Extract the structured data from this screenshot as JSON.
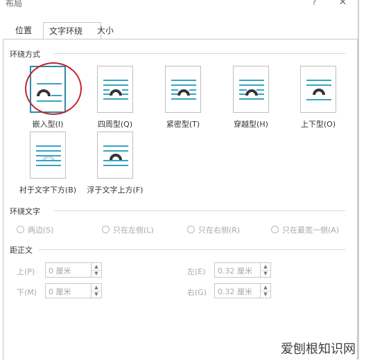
{
  "window": {
    "title": "布局",
    "help": "?",
    "close": "✕"
  },
  "tabs": [
    {
      "label": "位置",
      "active": false
    },
    {
      "label": "文字环绕",
      "active": true
    },
    {
      "label": "大小",
      "active": false
    }
  ],
  "wrap_style": {
    "section_label": "环绕方式",
    "options": [
      {
        "label": "嵌入型(I)",
        "selected": true
      },
      {
        "label": "四周型(Q)",
        "selected": false
      },
      {
        "label": "紧密型(T)",
        "selected": false
      },
      {
        "label": "穿越型(H)",
        "selected": false
      },
      {
        "label": "上下型(O)",
        "selected": false
      },
      {
        "label": "衬于文字下方(B)",
        "selected": false
      },
      {
        "label": "浮于文字上方(F)",
        "selected": false
      }
    ]
  },
  "wrap_text": {
    "section_label": "环绕文字",
    "options": [
      "两边(S)",
      "只在左侧(L)",
      "只在右侧(R)",
      "只在最宽一侧(A)"
    ]
  },
  "distance": {
    "section_label": "距正文",
    "top": {
      "label": "上(P)",
      "value": "0 厘米"
    },
    "bottom": {
      "label": "下(M)",
      "value": "0 厘米"
    },
    "left": {
      "label": "左(E)",
      "value": "0.32 厘米"
    },
    "right": {
      "label": "右(G)",
      "value": "0.32 厘米"
    }
  },
  "spinner": {
    "up": "▲",
    "down": "▼"
  },
  "watermark": "爱刨根知识网",
  "colors": {
    "accent": "#2b8aa8",
    "thumb_line": "#36a3c2",
    "highlight_ring": "#c4232d"
  }
}
